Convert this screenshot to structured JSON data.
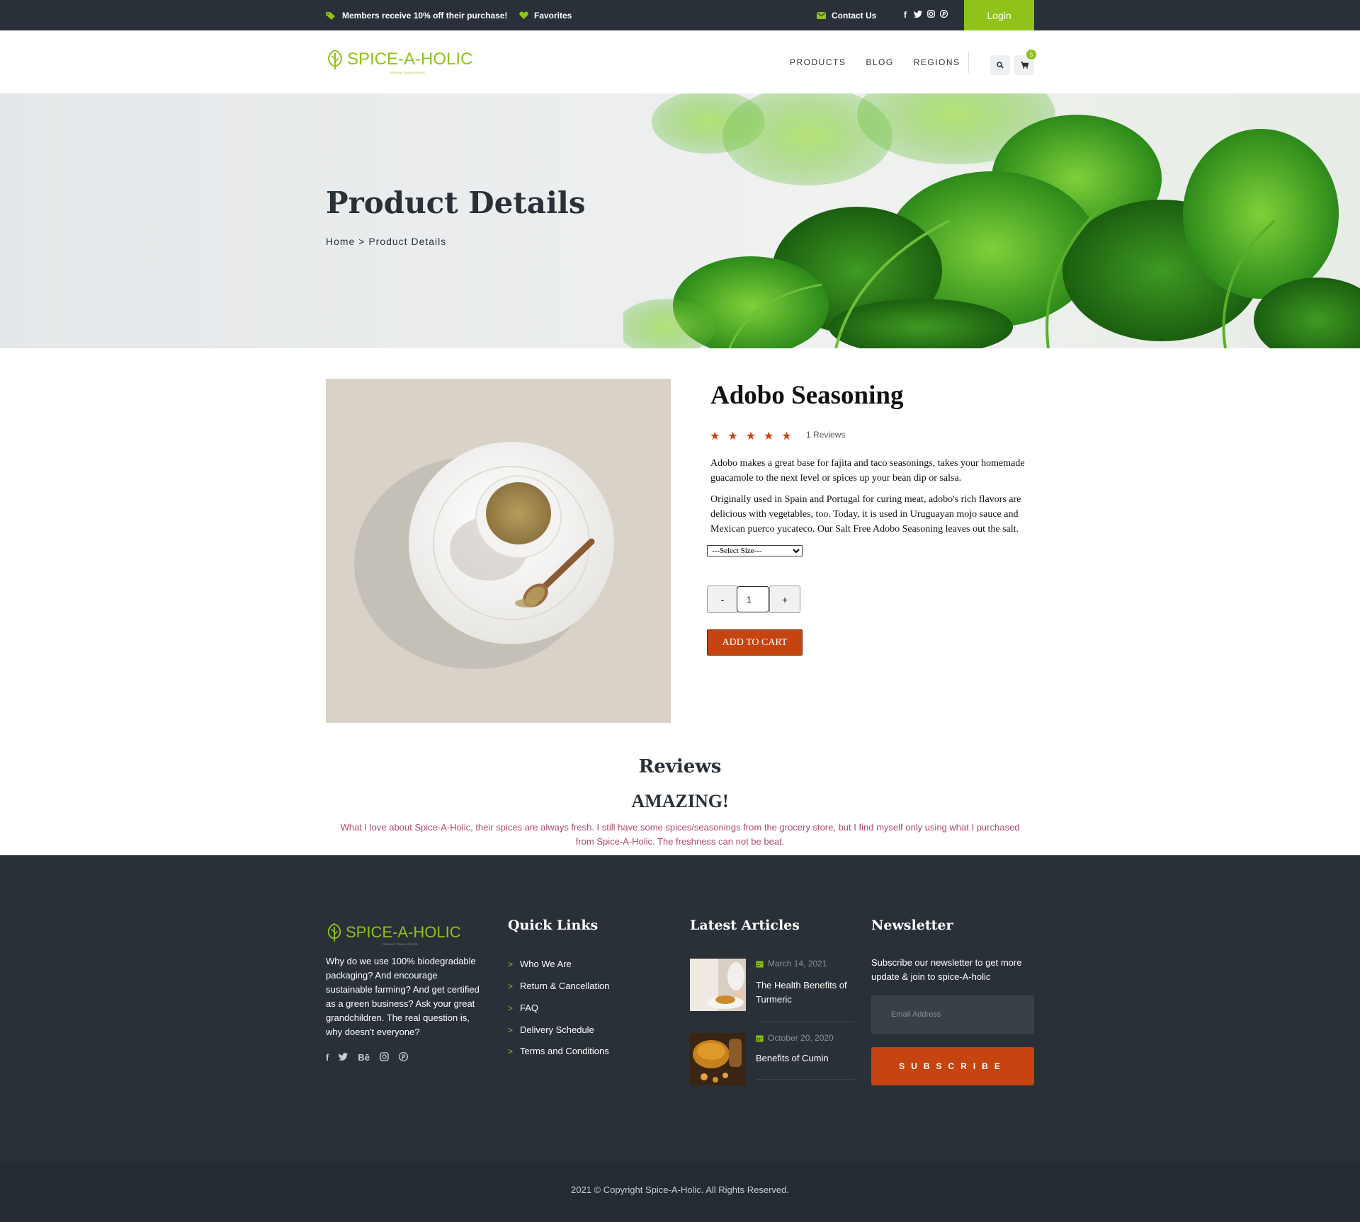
{
  "topbar": {
    "promo": "Members receive 10% off their purchase!",
    "favorites": "Favorites",
    "contact": "Contact Us",
    "social": [
      "f",
      "t",
      "ig",
      "p"
    ],
    "login": "Login"
  },
  "header": {
    "logo": "SPICE-A-HOLIC",
    "logo_tagline": "ORGANIC TEAS & SPICES",
    "nav": [
      "PRODUCTS",
      "BLOG",
      "REGIONS"
    ],
    "cart_count": "5"
  },
  "hero": {
    "title": "Product Details",
    "breadcrumb_home": "Home",
    "breadcrumb_sep": " > ",
    "breadcrumb_current": "Product Details"
  },
  "product": {
    "name": "Adobo Seasoning",
    "rating": 5,
    "reviews_label": "1 Reviews",
    "desc1": "Adobo makes a great base for fajita and taco seasonings, takes your homemade guacamole to the next level or spices up your bean dip or salsa.",
    "desc2": "Originally used in Spain and Portugal for curing meat, adobo's rich flavors are delicious with vegetables, too. Today, it is used in Uruguayan mojo sauce and Mexican puerco yucateco. Our Salt Free Adobo Seasoning leaves out the salt.",
    "size_select": "---Select Size---",
    "qty_minus": "-",
    "qty_value": "1",
    "qty_plus": "+",
    "add_to_cart": "ADD TO CART"
  },
  "reviews": {
    "title": "Reviews",
    "headline": "AMAZING!",
    "body": "What I love about Spice-A-Holic, their spices are always fresh. I still have some spices/seasonings from the grocery store, but I find myself only using what I purchased from Spice-A-Holic. The freshness can not be beat."
  },
  "footer": {
    "logo": "SPICE-A-HOLIC",
    "logo_tagline": "ORGANIC TEAS & SPICES",
    "about": "Why do we use 100% biodegradable packaging? And encourage sustainable farming? And get certified as a green business? Ask your great grandchildren. The real question is, why doesn't everyone?",
    "social": [
      "f",
      "t",
      "Bē",
      "ig",
      "p"
    ],
    "quick_links_title": "Quick Links",
    "quick_links": [
      "Who We Are",
      "Return & Cancellation",
      "FAQ",
      "Delivery Schedule",
      "Terms and Conditions"
    ],
    "articles_title": "Latest Articles",
    "articles": [
      {
        "date": "March 14, 2021",
        "title": "The Health Benefits of Turmeric"
      },
      {
        "date": "October 20, 2020",
        "title": "Benefits of Cumin"
      }
    ],
    "newsletter_title": "Newsletter",
    "newsletter_text": "Subscribe our newsletter to get more update & join to spice-A-holic",
    "email_placeholder": "Email Address",
    "subscribe": "SUBSCRIBE",
    "copyright": "2021 © Copyright Spice-A-Holic. All Rights Reserved."
  },
  "colors": {
    "accent_green": "#8fc319",
    "accent_orange": "#c64410",
    "dark": "#2a3038"
  }
}
